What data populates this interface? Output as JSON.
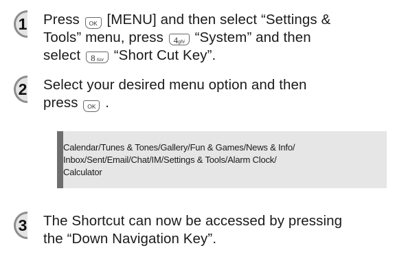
{
  "steps": [
    {
      "number": "1",
      "line1_a": "Press ",
      "line1_b": " [MENU] and then select “Settings &",
      "line2_a": "Tools” menu, press ",
      "line2_b": " “System” and then",
      "line3_a": "select ",
      "line3_b": " “Short Cut Key”."
    },
    {
      "number": "2",
      "line1": "Select your desired menu option and then",
      "line2_a": "press ",
      "line2_b": " ."
    },
    {
      "number": "3",
      "line1": "The Shortcut can now be accessed by pressing",
      "line2": "the “Down Navigation Key”."
    }
  ],
  "keys": {
    "ok": "OK",
    "four_num": "4",
    "four_sub": "ghi",
    "eight_num": "8",
    "eight_sub": "tuv"
  },
  "note": {
    "line1": "Calendar/Tunes & Tones/Gallery/Fun & Games/News & Info/",
    "line2": "Inbox/Sent/Email/Chat/IM/Settings & Tools/Alarm Clock/",
    "line3": "Calculator"
  }
}
